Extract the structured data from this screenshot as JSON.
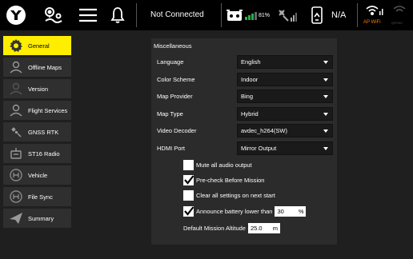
{
  "toolbar": {
    "connection_status": "Not Connected",
    "battery_percent": "81%",
    "gps_status": "N/A",
    "wifi_label": "AP WiFi",
    "wifi_off_label": "QSYNC"
  },
  "sidebar": {
    "items": [
      {
        "label": "General",
        "icon": "gear-icon",
        "active": true
      },
      {
        "label": "Offline Maps",
        "icon": "person-icon"
      },
      {
        "label": "Version",
        "icon": "person-icon"
      },
      {
        "label": "Flight Services",
        "icon": "person-icon"
      },
      {
        "label": "GNSS RTK",
        "icon": "satellite-icon"
      },
      {
        "label": "ST16 Radio",
        "icon": "radio-icon"
      },
      {
        "label": "Vehicle",
        "icon": "drone-icon"
      },
      {
        "label": "File Sync",
        "icon": "drone-icon"
      },
      {
        "label": "Summary",
        "icon": "paper-plane-icon"
      }
    ]
  },
  "panel": {
    "title": "Miscellaneous",
    "rows": [
      {
        "label": "Language",
        "value": "English"
      },
      {
        "label": "Color Scheme",
        "value": "Indoor"
      },
      {
        "label": "Map Provider",
        "value": "Bing"
      },
      {
        "label": "Map Type",
        "value": "Hybrid"
      },
      {
        "label": "Video Decoder",
        "value": "avdec_h264(SW)"
      },
      {
        "label": "HDMI Port",
        "value": "Mirror Output"
      }
    ],
    "checks": [
      {
        "label": "Mute all audio output",
        "checked": false
      },
      {
        "label": "Pre-check Before Mission",
        "checked": true
      },
      {
        "label": "Clear all settings on next start",
        "checked": false
      },
      {
        "label": "Announce battery lower than",
        "checked": true
      }
    ],
    "battery_threshold": "30",
    "battery_unit": "%",
    "altitude_label": "Default Mission Altitude",
    "altitude_value": "25.0",
    "altitude_unit": "m"
  }
}
